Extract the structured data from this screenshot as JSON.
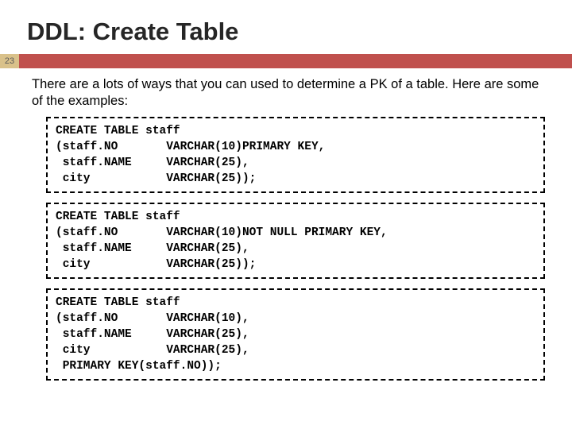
{
  "title": "DDL: Create Table",
  "page_number": "23",
  "intro": "There are a lots of ways that you can used to determine a PK of a table. Here are some of the examples:",
  "code_blocks": [
    "CREATE TABLE staff\n(staff.NO       VARCHAR(10)PRIMARY KEY,\n staff.NAME     VARCHAR(25),\n city           VARCHAR(25));",
    "CREATE TABLE staff\n(staff.NO       VARCHAR(10)NOT NULL PRIMARY KEY,\n staff.NAME     VARCHAR(25),\n city           VARCHAR(25));",
    "CREATE TABLE staff\n(staff.NO       VARCHAR(10),\n staff.NAME     VARCHAR(25),\n city           VARCHAR(25),\n PRIMARY KEY(staff.NO));"
  ]
}
